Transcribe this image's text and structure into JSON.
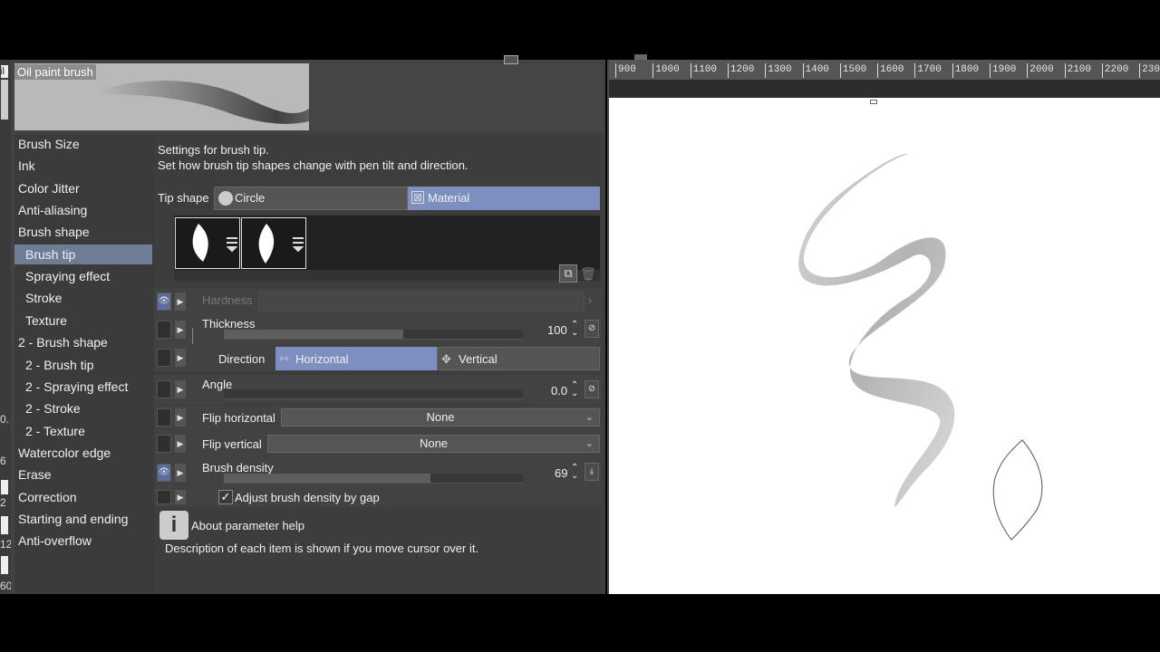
{
  "brush": {
    "name": "Oil paint brush"
  },
  "left_strip": {
    "fragments": [
      "il",
      "0.",
      "6",
      "2",
      "12",
      "60"
    ]
  },
  "categories": [
    {
      "label": "Brush Size",
      "sub": false,
      "selected": false
    },
    {
      "label": "Ink",
      "sub": false,
      "selected": false
    },
    {
      "label": "Color Jitter",
      "sub": false,
      "selected": false
    },
    {
      "label": "Anti-aliasing",
      "sub": false,
      "selected": false
    },
    {
      "label": "Brush shape",
      "sub": false,
      "selected": false
    },
    {
      "label": "Brush tip",
      "sub": true,
      "selected": true
    },
    {
      "label": "Spraying effect",
      "sub": true,
      "selected": false
    },
    {
      "label": "Stroke",
      "sub": true,
      "selected": false
    },
    {
      "label": "Texture",
      "sub": true,
      "selected": false
    },
    {
      "label": "2 - Brush shape",
      "sub": false,
      "selected": false
    },
    {
      "label": "2 - Brush tip",
      "sub": true,
      "selected": false
    },
    {
      "label": "2 - Spraying effect",
      "sub": true,
      "selected": false
    },
    {
      "label": "2 - Stroke",
      "sub": true,
      "selected": false
    },
    {
      "label": "2 - Texture",
      "sub": true,
      "selected": false
    },
    {
      "label": "Watercolor edge",
      "sub": false,
      "selected": false
    },
    {
      "label": "Erase",
      "sub": false,
      "selected": false
    },
    {
      "label": "Correction",
      "sub": false,
      "selected": false
    },
    {
      "label": "Starting and ending",
      "sub": false,
      "selected": false
    },
    {
      "label": "Anti-overflow",
      "sub": false,
      "selected": false
    }
  ],
  "settings": {
    "desc1": "Settings for brush tip.",
    "desc2": "Set how brush tip shapes change with pen tilt and direction.",
    "tip_shape": {
      "label": "Tip shape",
      "circle": "Circle",
      "material": "Material",
      "selected": "Material"
    },
    "hardness": {
      "label": "Hardness"
    },
    "thickness": {
      "label": "Thickness",
      "value": "100",
      "fill": 0.6
    },
    "direction": {
      "label": "Direction",
      "horizontal": "Horizontal",
      "vertical": "Vertical",
      "selected": "Horizontal"
    },
    "angle": {
      "label": "Angle",
      "value": "0.0"
    },
    "flip_horizontal": {
      "label": "Flip horizontal",
      "value": "None"
    },
    "flip_vertical": {
      "label": "Flip vertical",
      "value": "None"
    },
    "brush_density": {
      "label": "Brush density",
      "value": "69",
      "fill": 0.69
    },
    "adjust_density": {
      "label": "Adjust brush density by gap",
      "checked": true
    },
    "help_title": "About parameter help",
    "help_desc": "Description of each item is shown if you move cursor over it."
  },
  "ruler": {
    "ticks": [
      "900",
      "1000",
      "1100",
      "1200",
      "1300",
      "1400",
      "1500",
      "1600",
      "1700",
      "1800",
      "1900",
      "2000",
      "2100",
      "2200",
      "230"
    ]
  },
  "colors": {
    "accent": "#6f7c96",
    "selected_button": "#7d8fbe",
    "panel": "#434343",
    "paper": "#ffffff"
  }
}
